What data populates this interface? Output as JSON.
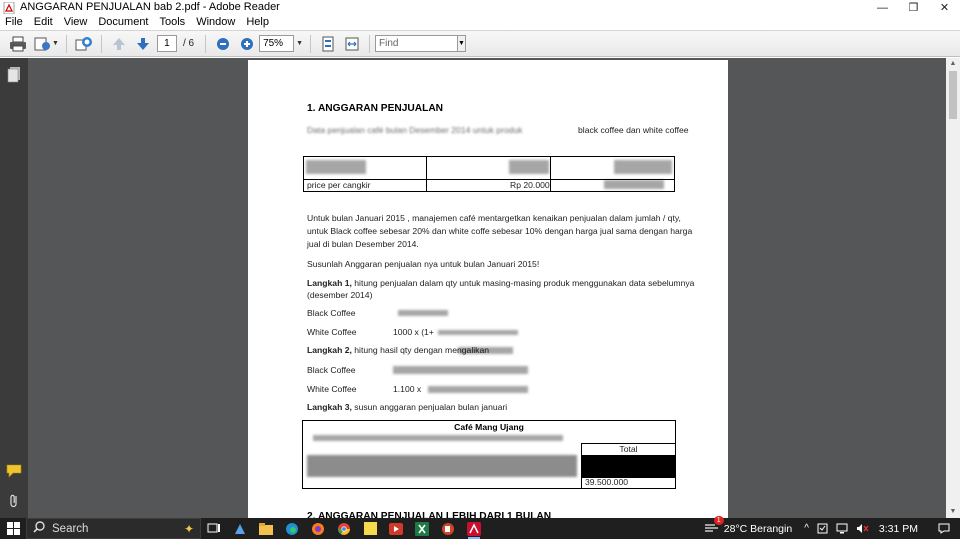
{
  "window": {
    "title": "ANGGARAN PENJUALAN bab 2.pdf - Adobe Reader",
    "controls": {
      "minimize": "—",
      "restore": "❐",
      "close": "✕"
    }
  },
  "menu": [
    "File",
    "Edit",
    "View",
    "Document",
    "Tools",
    "Window",
    "Help"
  ],
  "toolbar": {
    "page_current": "1",
    "page_total": "/ 6",
    "zoom": "75%",
    "find_placeholder": "Find"
  },
  "document": {
    "h1": "1.  ANGGARAN PENJUALAN",
    "intro_tail": "black coffee dan white coffee",
    "table1_label": "price per cangkir",
    "table1_value": "Rp 20.000",
    "para1_line1": "Untuk bulan Januari 2015 , manajemen café mentargetkan kenaikan penjualan dalam jumlah / qty,",
    "para1_line2": "untuk Black coffee sebesar 20% dan white coffe sebesar 10% dengan harga jual sama dengan harga",
    "para1_line3": "jual di bulan Desember 2014.",
    "task": "Susunlah Anggaran penjualan nya untuk bulan Januari 2015!",
    "step1_bold": "Langkah 1,",
    "step1_text": " hitung penjualan dalam qty untuk masing-masing produk menggunakan data sebelumnya",
    "step1_text2": "(desember 2014)",
    "black_coffee": "Black Coffee",
    "white_coffee": "White Coffee",
    "white_calc1": "1000 x (1+",
    "step2_bold": "Langkah 2,",
    "step2_text": " hitung hasil qty dengan mengalikan",
    "white_calc2": "1.100 x",
    "step3_bold": "Langkah 3,",
    "step3_text": " susun anggaran penjualan bulan januari",
    "table2_title": "Café Mang Ujang",
    "table2_total_label": "Total",
    "table2_total_value": "39.500.000",
    "h2": "2.  ANGGARAN PENJUALAN LEBIH DARI 1 BULAN"
  },
  "taskbar": {
    "search_label": "Search",
    "weather": "28°C  Berangin",
    "time": "3:31 PM",
    "notif_count": "1"
  },
  "colors": {
    "doc_bg": "#555657",
    "nav_bg": "#3b3b3b",
    "taskbar_bg": "#1f1f1f",
    "black_fill": "#000000"
  }
}
